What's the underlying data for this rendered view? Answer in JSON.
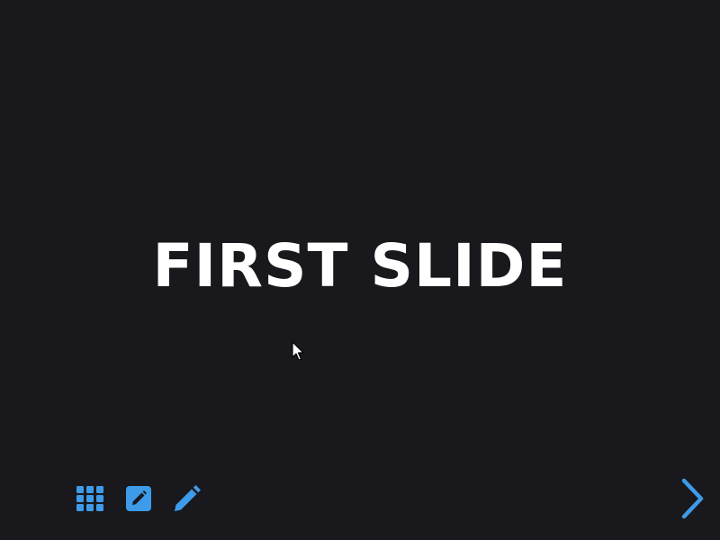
{
  "slide": {
    "title": "FIRST SLIDE"
  },
  "toolbar": {
    "buttons": [
      {
        "name": "overview-grid",
        "icon": "grid-icon",
        "color": "#3d9be9"
      },
      {
        "name": "edit-slide",
        "icon": "edit-square-icon",
        "color": "#3d9be9"
      },
      {
        "name": "draw",
        "icon": "pencil-icon",
        "color": "#3d9be9"
      }
    ]
  },
  "navigation": {
    "next_icon": "chevron-right-icon",
    "color": "#3d9be9"
  },
  "colors": {
    "background": "#19181c",
    "text": "#ffffff",
    "accent": "#3d9be9"
  }
}
